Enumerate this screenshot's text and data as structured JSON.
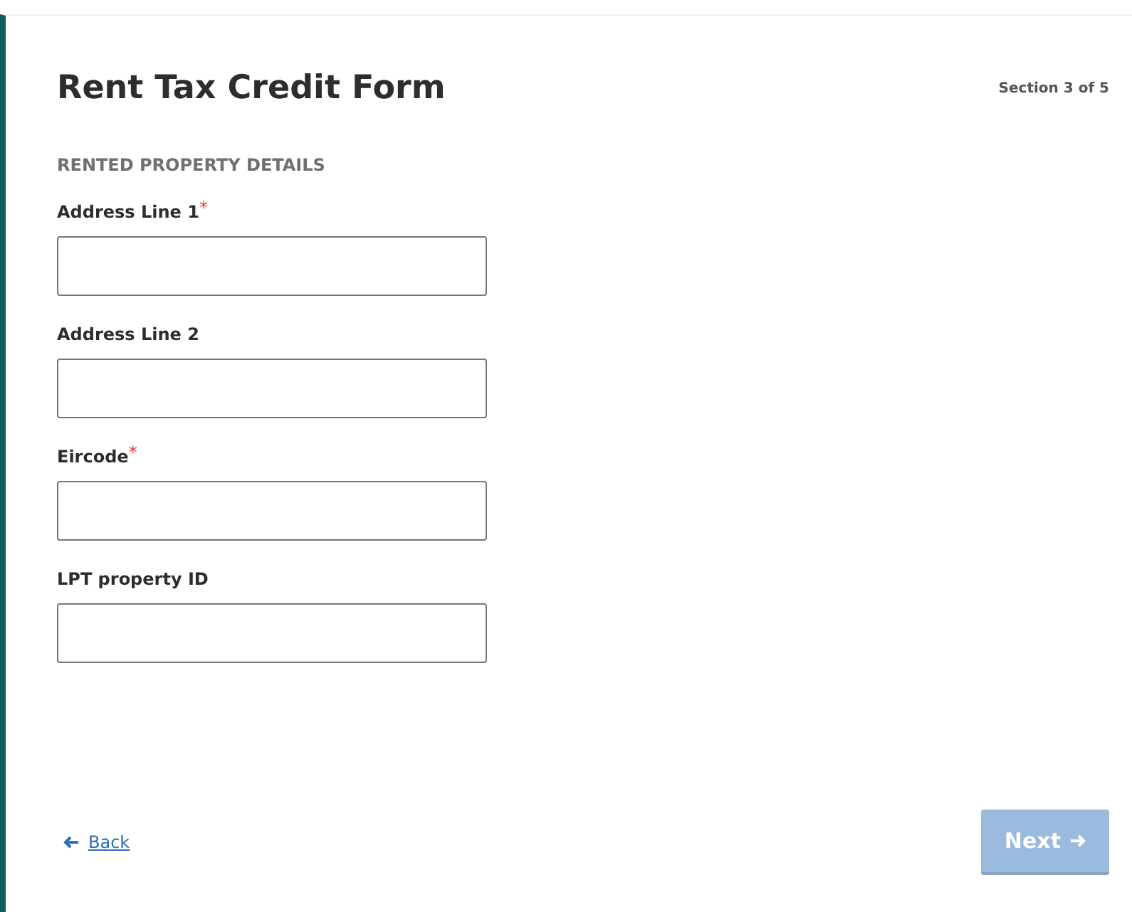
{
  "form": {
    "title": "Rent Tax Credit Form",
    "progress": "Section 3 of 5",
    "section_heading": "RENTED PROPERTY DETAILS",
    "fields": [
      {
        "label": "Address Line 1",
        "required_mark": "*"
      },
      {
        "label": "Address Line 2"
      },
      {
        "label": "Eircode",
        "required_mark": "*"
      },
      {
        "label": "LPT property ID"
      }
    ],
    "back_link": {
      "label": "Back"
    },
    "next_button": {
      "label": "Next",
      "disabled": true
    }
  }
}
